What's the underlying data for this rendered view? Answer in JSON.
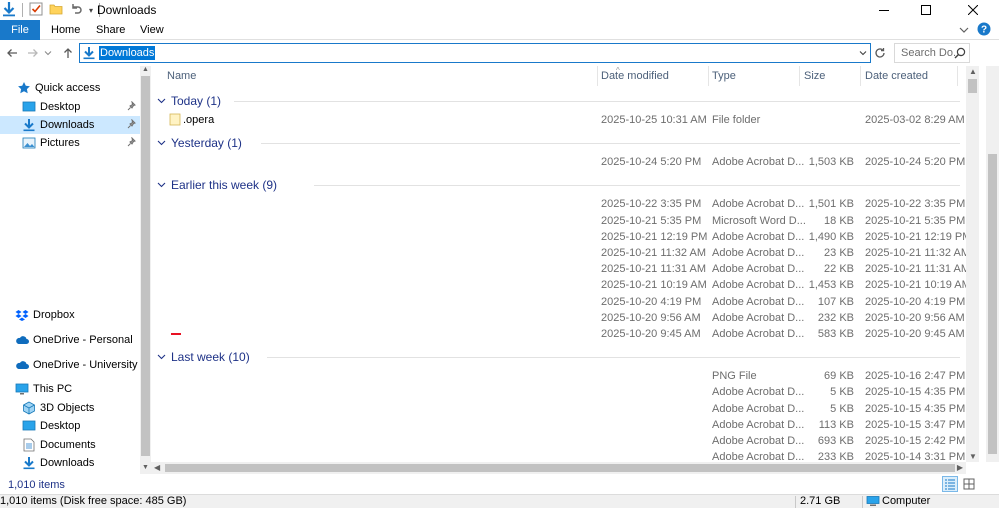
{
  "window": {
    "title": "Downloads"
  },
  "ribbon": {
    "tabs": [
      "File",
      "Home",
      "Share",
      "View"
    ]
  },
  "address": {
    "path": "Downloads",
    "search_placeholder": "Search Do..."
  },
  "sidebar": {
    "items": [
      {
        "label": "Quick access",
        "icon": "star-icon",
        "pinned": false
      },
      {
        "label": "Desktop",
        "icon": "desktop-icon",
        "pinned": true
      },
      {
        "label": "Downloads",
        "icon": "download-icon",
        "pinned": true,
        "selected": true
      },
      {
        "label": "Pictures",
        "icon": "pictures-icon",
        "pinned": true
      },
      {
        "label": "Dropbox",
        "icon": "dropbox-icon",
        "pinned": false
      },
      {
        "label": "OneDrive - Personal",
        "icon": "cloud-icon",
        "pinned": false
      },
      {
        "label": "OneDrive - University of W",
        "icon": "cloud-icon",
        "pinned": false
      },
      {
        "label": "This PC",
        "icon": "pc-icon",
        "pinned": false
      },
      {
        "label": "3D Objects",
        "icon": "cube-icon",
        "pinned": false
      },
      {
        "label": "Desktop",
        "icon": "desktop-icon",
        "pinned": false
      },
      {
        "label": "Documents",
        "icon": "documents-icon",
        "pinned": false
      },
      {
        "label": "Downloads",
        "icon": "download-icon",
        "pinned": false
      }
    ]
  },
  "columns": {
    "name": "Name",
    "date_modified": "Date modified",
    "type": "Type",
    "size": "Size",
    "date_created": "Date created"
  },
  "groups": [
    {
      "label": "Today (1)",
      "rows": [
        {
          "name": ".opera",
          "modified": "2025-10-25 10:31 AM",
          "type": "File folder",
          "size": "",
          "created": "2025-03-02 8:29 AM"
        }
      ]
    },
    {
      "label": "Yesterday (1)",
      "rows": [
        {
          "name": "",
          "modified": "2025-10-24 5:20 PM",
          "type": "Adobe Acrobat D...",
          "size": "1,503 KB",
          "created": "2025-10-24 5:20 PM"
        }
      ]
    },
    {
      "label": "Earlier this week (9)",
      "rows": [
        {
          "name": "",
          "modified": "2025-10-22 3:35 PM",
          "type": "Adobe Acrobat D...",
          "size": "1,501 KB",
          "created": "2025-10-22 3:35 PM"
        },
        {
          "name": "",
          "modified": "2025-10-21 5:35 PM",
          "type": "Microsoft Word D...",
          "size": "18 KB",
          "created": "2025-10-21 5:35 PM"
        },
        {
          "name": "",
          "modified": "2025-10-21 12:19 PM",
          "type": "Adobe Acrobat D...",
          "size": "1,490 KB",
          "created": "2025-10-21 12:19 PM"
        },
        {
          "name": "",
          "modified": "2025-10-21 11:32 AM",
          "type": "Adobe Acrobat D...",
          "size": "23 KB",
          "created": "2025-10-21 11:32 AM"
        },
        {
          "name": "",
          "modified": "2025-10-21 11:31 AM",
          "type": "Adobe Acrobat D...",
          "size": "22 KB",
          "created": "2025-10-21 11:31 AM"
        },
        {
          "name": "",
          "modified": "2025-10-21 10:19 AM",
          "type": "Adobe Acrobat D...",
          "size": "1,453 KB",
          "created": "2025-10-21 10:19 AM"
        },
        {
          "name": "",
          "modified": "2025-10-20 4:19 PM",
          "type": "Adobe Acrobat D...",
          "size": "107 KB",
          "created": "2025-10-20 4:19 PM"
        },
        {
          "name": "",
          "modified": "2025-10-20 9:56 AM",
          "type": "Adobe Acrobat D...",
          "size": "232 KB",
          "created": "2025-10-20 9:56 AM"
        },
        {
          "name": "",
          "modified": "2025-10-20 9:45 AM",
          "type": "Adobe Acrobat D...",
          "size": "583 KB",
          "created": "2025-10-20 9:45 AM"
        }
      ]
    },
    {
      "label": "Last week (10)",
      "rows": [
        {
          "name": "",
          "modified": "",
          "type": "PNG File",
          "size": "69 KB",
          "created": "2025-10-16 2:47 PM"
        },
        {
          "name": "",
          "modified": "",
          "type": "Adobe Acrobat D...",
          "size": "5 KB",
          "created": "2025-10-15 4:35 PM"
        },
        {
          "name": "",
          "modified": "",
          "type": "Adobe Acrobat D...",
          "size": "5 KB",
          "created": "2025-10-15 4:35 PM"
        },
        {
          "name": "",
          "modified": "",
          "type": "Adobe Acrobat D...",
          "size": "113 KB",
          "created": "2025-10-15 3:47 PM"
        },
        {
          "name": "",
          "modified": "",
          "type": "Adobe Acrobat D...",
          "size": "693 KB",
          "created": "2025-10-15 2:42 PM"
        },
        {
          "name": "",
          "modified": "",
          "type": "Adobe Acrobat D...",
          "size": "233 KB",
          "created": "2025-10-14 3:31 PM"
        }
      ]
    }
  ],
  "status": {
    "item_count": "1,010 items",
    "disk_info": "1,010 items (Disk free space: 485 GB)",
    "total_size": "2.71 GB",
    "location": "Computer"
  },
  "colors": {
    "accent": "#1979ca",
    "selection": "#cce8ff",
    "group_text": "#1e3287"
  }
}
